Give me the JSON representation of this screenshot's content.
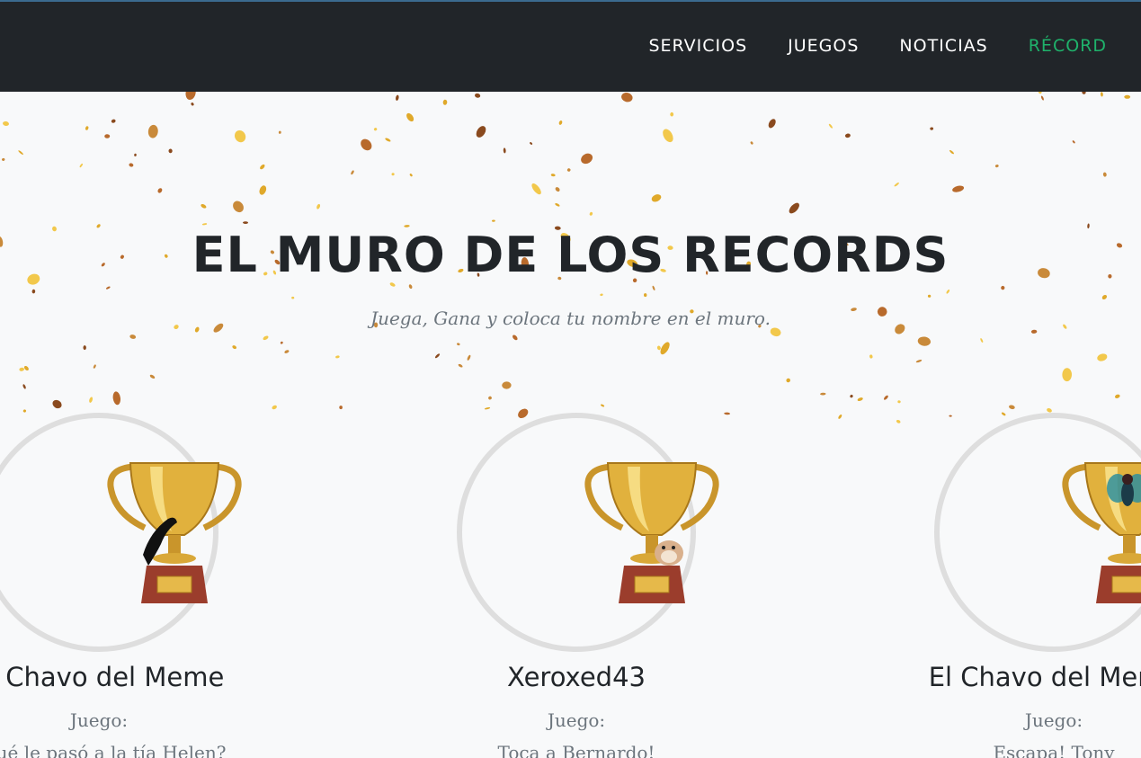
{
  "nav": {
    "items": [
      {
        "label": "SERVICIOS",
        "active": false
      },
      {
        "label": "JUEGOS",
        "active": false
      },
      {
        "label": "NOTICIAS",
        "active": false
      },
      {
        "label": "RÉCORD",
        "active": true
      }
    ],
    "active_color": "#1fb26b"
  },
  "hero": {
    "title": "EL MURO DE LOS RECORDS",
    "subtitle": "Juega, Gana y coloca tu nombre en el muro."
  },
  "records": [
    {
      "player": "El Chavo del Meme",
      "game_label": "Juego:",
      "game": "¿Qué le pasó a la tía Helen?",
      "icon": "trophy-cat-icon"
    },
    {
      "player": "Xeroxed43",
      "game_label": "Juego:",
      "game": "Toca a Bernardo!",
      "icon": "trophy-hamster-icon"
    },
    {
      "player": "El Chavo del Meme",
      "game_label": "Juego:",
      "game": "Escapa! Tony",
      "icon": "trophy-fly-icon"
    }
  ],
  "colors": {
    "header_bg": "#212529",
    "page_bg": "#f8f9fa",
    "confetti_gold": "#e0a92a"
  }
}
